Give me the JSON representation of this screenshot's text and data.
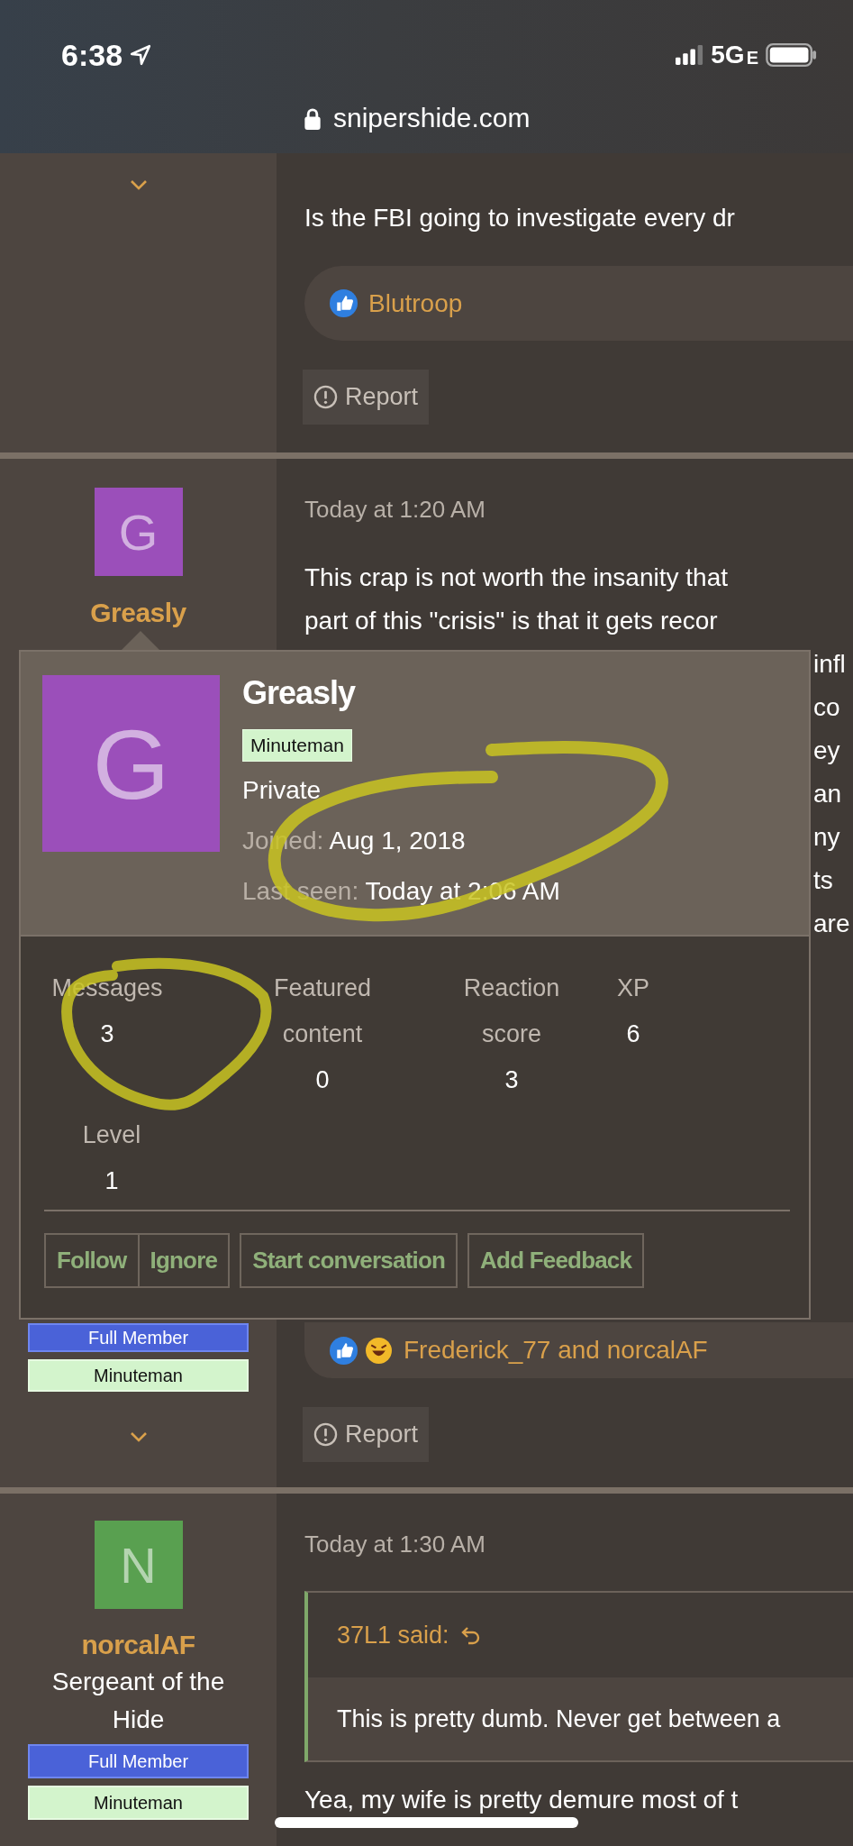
{
  "status_bar": {
    "time": "6:38",
    "network": "5G",
    "network_suffix": "E"
  },
  "address_bar": {
    "url": "snipershide.com"
  },
  "first_post": {
    "body": "Is the FBI going to investigate every dr",
    "reactions": {
      "icons": [
        {
          "kind": "like"
        }
      ],
      "text": "Blutroop"
    },
    "report": "Report"
  },
  "second_post": {
    "author": {
      "initial": "G",
      "color": "#9b4fba",
      "name": "Greasly",
      "badges": [
        {
          "label": "Full Member",
          "kind": "primary"
        },
        {
          "label": "Minuteman",
          "kind": "secondary"
        }
      ]
    },
    "time": "Today at 1:20 AM",
    "body_lines": [
      "This crap is not worth the insanity that",
      "part of this \"crisis\" is that it gets recor"
    ],
    "body_fragments": [
      "infl",
      "co",
      "ey",
      "an",
      "ny",
      "ts",
      "are"
    ],
    "reactions": {
      "icons": [
        {
          "kind": "like"
        },
        {
          "kind": "laugh"
        }
      ],
      "text": "Frederick_77 and norcalAF"
    },
    "report": "Report"
  },
  "third_post": {
    "author": {
      "initial": "N",
      "color": "#59a050",
      "name": "norcalAF",
      "title": "Sergeant of the Hide",
      "badges": [
        {
          "label": "Full Member",
          "kind": "primary"
        },
        {
          "label": "Minuteman",
          "kind": "secondary"
        }
      ]
    },
    "time": "Today at 1:30 AM",
    "quote": {
      "author": "37L1 said:",
      "text": "This is pretty dumb. Never get between a"
    },
    "body": "Yea, my wife is pretty demure most of t"
  },
  "member_card": {
    "initial": "G",
    "color": "#9b4fba",
    "name": "Greasly",
    "banner": "Minuteman",
    "title": "Private",
    "joined": {
      "label": "Joined:",
      "value": "Aug 1, 2018"
    },
    "last_seen": {
      "label": "Last seen:",
      "value": "Today at 2:06 AM"
    },
    "stats": [
      {
        "label": "Messages",
        "value": "3"
      },
      {
        "label": "Featured content",
        "value": "0"
      },
      {
        "label": "Reaction score",
        "value": "3"
      },
      {
        "label": "XP",
        "value": "6"
      }
    ],
    "level": {
      "label": "Level",
      "value": "1"
    },
    "buttons": [
      "Follow",
      "Ignore",
      "Start conversation",
      "Add Feedback"
    ]
  }
}
